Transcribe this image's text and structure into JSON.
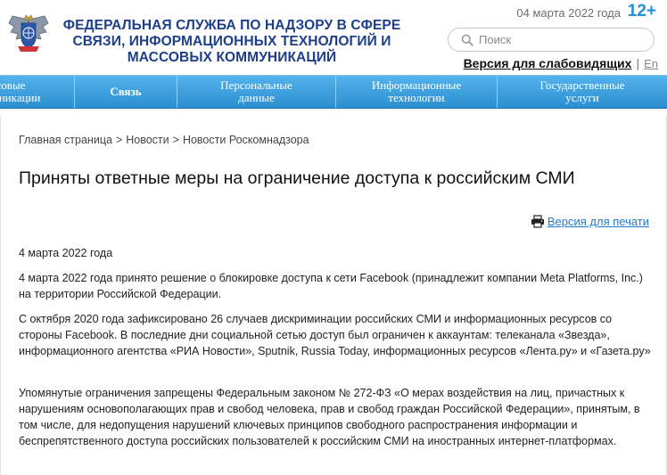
{
  "header": {
    "org_title": "ФЕДЕРАЛЬНАЯ СЛУЖБА ПО НАДЗОРУ В СФЕРЕ СВЯЗИ, ИНФОРМАЦИОННЫХ ТЕХНОЛОГИЙ И МАССОВЫХ КОММУНИКАЦИЙ",
    "date": "04 марта 2022 года",
    "age_rating": "12+",
    "search_placeholder": "Поиск",
    "a11y_label": "Версия для слабовидящих",
    "lang_separator": "|",
    "lang_en": "En"
  },
  "nav": {
    "items": [
      {
        "label": "Массовые коммуникации",
        "line1": "ассовые",
        "line2": "муникации"
      },
      {
        "label": "Связь",
        "line1": "Связь",
        "line2": ""
      },
      {
        "label": "Персональные данные",
        "line1": "Персональные",
        "line2": "данные"
      },
      {
        "label": "Информационные технологии",
        "line1": "Информационные",
        "line2": "технологии"
      },
      {
        "label": "Государственные услуги",
        "line1": "Государственные",
        "line2": "услуги"
      }
    ]
  },
  "breadcrumb": {
    "items": [
      "Главная страница",
      "Новости",
      "Новости Роскомнадзора"
    ],
    "separator": ">"
  },
  "article": {
    "title": "Приняты ответные меры на ограничение доступа к российским СМИ",
    "print_label": "Версия для печати",
    "date": "4 марта 2022 года",
    "paragraphs": [
      "4 марта 2022 года принято решение о блокировке доступа к сети Facebook (принадлежит компании Meta Platforms, Inc.) на территории Российской Федерации.",
      "С октября 2020 года зафиксировано 26 случаев дискриминации российских СМИ и информационных ресурсов со стороны Facebook. В последние дни социальной сетью доступ был ограничен к аккаунтам: телеканала «Звезда», информационного агентства «РИА Новости», Sputnik, Russia Today, информационных ресурсов «Лента.ру» и «Газета.ру»",
      "Упомянутые ограничения запрещены Федеральным законом № 272-ФЗ «О мерах воздействия на лиц, причастных к нарушениям основополагающих прав и свобод человека, прав и свобод граждан Российской Федерации», принятым, в том числе, для недопущения нарушений ключевых принципов свободного распространения информации и беспрепятственного доступа российских пользователей к российским СМИ на иностранных интернет-платформах."
    ]
  },
  "colors": {
    "title_blue": "#1d3f8a",
    "nav_blue": "#2a8fd0",
    "link_blue": "#1f7ad0",
    "age_blue": "#1f8fe0"
  },
  "icons": {
    "emblem": "emblem-icon",
    "search": "search-icon",
    "print": "printer-icon"
  }
}
